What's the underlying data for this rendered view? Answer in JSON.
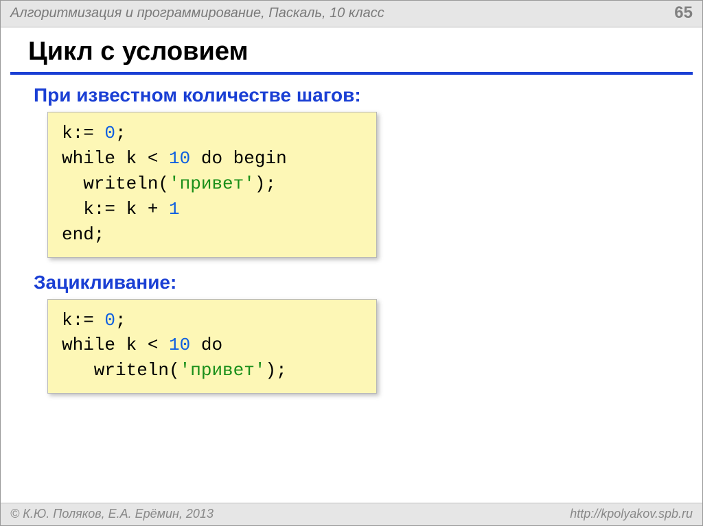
{
  "header": {
    "course": "Алгоритмизация и программирование, Паскаль, 10 класс",
    "page": "65"
  },
  "title": "Цикл с условием",
  "section1": {
    "heading": "При известном количестве шагов:",
    "code": {
      "l1a": "k:= ",
      "l1n": "0",
      "l1b": ";",
      "l2a": "while k < ",
      "l2n": "10",
      "l2b": " do begin",
      "l3a": "  writeln(",
      "l3s": "'привет'",
      "l3b": ");",
      "l4a": "  k:= k + ",
      "l4n": "1",
      "l5": "end;"
    }
  },
  "section2": {
    "heading": "Зацикливание:",
    "code": {
      "l1a": "k:= ",
      "l1n": "0",
      "l1b": ";",
      "l2a": "while k < ",
      "l2n": "10",
      "l2b": " do",
      "l3a": "   writeln(",
      "l3s": "'привет'",
      "l3b": ");"
    }
  },
  "footer": {
    "copyright": "© К.Ю. Поляков, Е.А. Ерёмин, 2013",
    "url": "http://kpolyakov.spb.ru"
  }
}
